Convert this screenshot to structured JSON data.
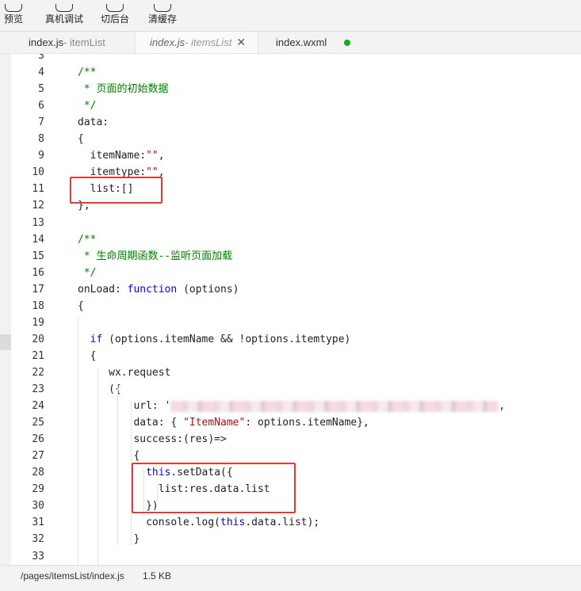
{
  "toolbar": {
    "items": [
      {
        "label": "预览",
        "icon": "eye-icon"
      },
      {
        "label": "真机调试",
        "icon": "phone-debug-icon"
      },
      {
        "label": "切后台",
        "icon": "switch-background-icon"
      },
      {
        "label": "清缓存",
        "icon": "layers-icon"
      }
    ]
  },
  "tabs": [
    {
      "name": "index.js",
      "sub": " - itemList",
      "active": false
    },
    {
      "name": "index.js",
      "sub": " - itemsList",
      "active": true,
      "close": "✕"
    },
    {
      "name": "index.wxml",
      "sub": "",
      "active": false,
      "modified_dot": true
    }
  ],
  "editor": {
    "lines": [
      {
        "n": "3",
        "segs": []
      },
      {
        "n": "4",
        "segs": [
          {
            "t": "/**",
            "c": "comment"
          }
        ]
      },
      {
        "n": "5",
        "segs": [
          {
            "t": " * 页面的初始数据",
            "c": "comment"
          }
        ]
      },
      {
        "n": "6",
        "segs": [
          {
            "t": " */",
            "c": "comment"
          }
        ]
      },
      {
        "n": "7",
        "segs": [
          {
            "t": "data:",
            "c": ""
          }
        ]
      },
      {
        "n": "8",
        "segs": [
          {
            "t": "{",
            "c": ""
          }
        ]
      },
      {
        "n": "9",
        "segs": [
          {
            "t": "  itemName:",
            "c": ""
          },
          {
            "t": "\"\"",
            "c": "str"
          },
          {
            "t": ",",
            "c": ""
          }
        ]
      },
      {
        "n": "10",
        "segs": [
          {
            "t": "  itemtype:",
            "c": ""
          },
          {
            "t": "\"\"",
            "c": "str"
          },
          {
            "t": ",",
            "c": ""
          }
        ]
      },
      {
        "n": "11",
        "segs": [
          {
            "t": "  list:[]",
            "c": ""
          }
        ]
      },
      {
        "n": "12",
        "segs": [
          {
            "t": "},",
            "c": ""
          }
        ]
      },
      {
        "n": "13",
        "segs": []
      },
      {
        "n": "14",
        "segs": [
          {
            "t": "/**",
            "c": "comment"
          }
        ]
      },
      {
        "n": "15",
        "segs": [
          {
            "t": " * 生命周期函数--监听页面加载",
            "c": "comment"
          }
        ]
      },
      {
        "n": "16",
        "segs": [
          {
            "t": " */",
            "c": "comment"
          }
        ]
      },
      {
        "n": "17",
        "segs": [
          {
            "t": "onLoad: ",
            "c": ""
          },
          {
            "t": "function",
            "c": "kw"
          },
          {
            "t": " (options)",
            "c": ""
          }
        ]
      },
      {
        "n": "18",
        "segs": [
          {
            "t": "{",
            "c": ""
          }
        ]
      },
      {
        "n": "19",
        "segs": []
      },
      {
        "n": "20",
        "segs": [
          {
            "t": "  ",
            "c": ""
          },
          {
            "t": "if",
            "c": "kw"
          },
          {
            "t": " (options.itemName && !options.itemtype)",
            "c": ""
          }
        ]
      },
      {
        "n": "21",
        "segs": [
          {
            "t": "  {",
            "c": ""
          }
        ]
      },
      {
        "n": "22",
        "segs": [
          {
            "t": "     wx.request",
            "c": ""
          }
        ]
      },
      {
        "n": "23",
        "segs": [
          {
            "t": "     ({",
            "c": ""
          }
        ]
      },
      {
        "n": "24",
        "segs": [
          {
            "t": "         url: '",
            "c": ""
          },
          {
            "t": "",
            "c": "blur"
          },
          {
            "t": ",",
            "c": ""
          }
        ]
      },
      {
        "n": "25",
        "segs": [
          {
            "t": "         data: { ",
            "c": ""
          },
          {
            "t": "\"ItemName\"",
            "c": "str"
          },
          {
            "t": ": options.itemName},",
            "c": ""
          }
        ]
      },
      {
        "n": "26",
        "segs": [
          {
            "t": "         success:(res)=>",
            "c": ""
          }
        ]
      },
      {
        "n": "27",
        "segs": [
          {
            "t": "         {",
            "c": ""
          }
        ]
      },
      {
        "n": "28",
        "segs": [
          {
            "t": "           ",
            "c": ""
          },
          {
            "t": "this",
            "c": "kw"
          },
          {
            "t": ".setData({",
            "c": ""
          }
        ]
      },
      {
        "n": "29",
        "segs": [
          {
            "t": "             list:res.data.list",
            "c": ""
          }
        ]
      },
      {
        "n": "30",
        "segs": [
          {
            "t": "           })",
            "c": ""
          }
        ]
      },
      {
        "n": "31",
        "segs": [
          {
            "t": "           console.log(",
            "c": ""
          },
          {
            "t": "this",
            "c": "kw"
          },
          {
            "t": ".data.list);",
            "c": ""
          }
        ]
      },
      {
        "n": "32",
        "segs": [
          {
            "t": "         }",
            "c": ""
          }
        ]
      },
      {
        "n": "33",
        "segs": []
      },
      {
        "n": "",
        "segs": [
          {
            "t": "     },",
            "c": ""
          }
        ]
      }
    ]
  },
  "statusbar": {
    "path": "/pages/itemsList/index.js",
    "size": "1.5 KB"
  },
  "colors": {
    "comment": "#008000",
    "string": "#a31515",
    "keyword": "#0000ff",
    "highlight_box": "#e53935",
    "modified_dot": "#1aad19"
  }
}
